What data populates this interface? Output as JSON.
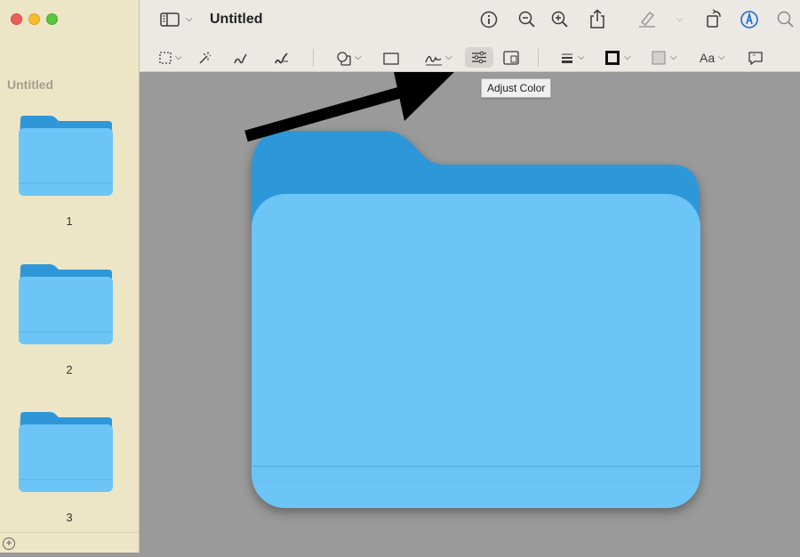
{
  "window": {
    "title": "Untitled"
  },
  "sidebar": {
    "title": "Untitled",
    "pages": [
      {
        "label": "1"
      },
      {
        "label": "2"
      },
      {
        "label": "3"
      }
    ]
  },
  "tooltip": {
    "text": "Adjust Color"
  },
  "toolbar": {
    "text_style_label": "Aa"
  },
  "colors": {
    "folder_back": "#2f97d8",
    "folder_front": "#6cc5f6",
    "sidebar_bg": "#ede6c6",
    "canvas_bg": "#9a9a9a",
    "accent": "#1a6cd6"
  }
}
